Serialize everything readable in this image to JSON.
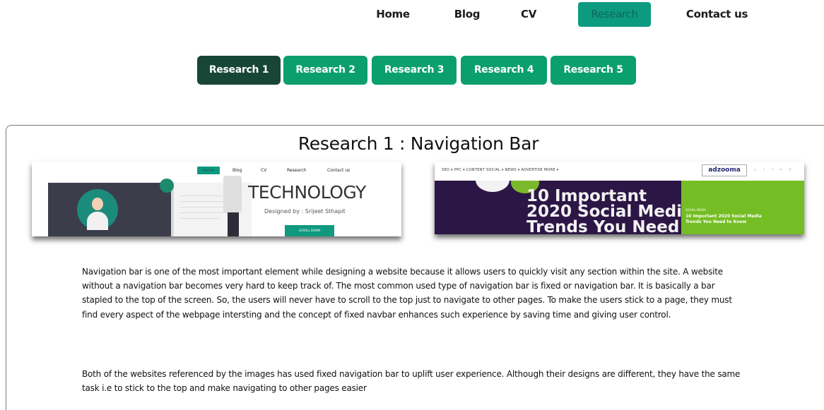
{
  "nav": {
    "items": [
      {
        "label": "Home"
      },
      {
        "label": "Blog"
      },
      {
        "label": "CV"
      },
      {
        "label": "Research",
        "active": true
      },
      {
        "label": "Contact us"
      }
    ]
  },
  "tabs": [
    {
      "label": "Research 1",
      "active": true
    },
    {
      "label": "Research 2"
    },
    {
      "label": "Research 3"
    },
    {
      "label": "Research 4"
    },
    {
      "label": "Research 5"
    }
  ],
  "panel": {
    "title": "Research 1 : Navigation Bar",
    "paragraphs": [
      "Navigation bar is one of the most important element while designing a website because it allows users to quickly visit any section within the site. A website without a navigation bar becomes very hard to keep track of. The most common used type of navigation bar is fixed or navigation bar. It is basically a bar stapled to the top of the screen. So, the users will never have to scroll to the top just to navigate to other pages. To make the users stick to a page, they must find every aspect of the webpage intersting and the concept of fixed navbar enhances such experience by saving time and giving user control.",
      "Both of the websites referenced by the images has used fixed navigation bar to uplift user experience. Although their designs are different, they have the same task i.e to stick to the top and make navigating to other pages easier"
    ]
  },
  "screenshot1": {
    "nav": [
      "Home",
      "Blog",
      "CV",
      "Research",
      "Contact us"
    ],
    "headline": "TECHNOLOGY",
    "designed_by": "Designed by : Srijeet Sthapit",
    "scroll_button": "SCROLL DOWN"
  },
  "screenshot2": {
    "menu": "SEO ▾    PPC ▾    CONTENT    SOCIAL ▾    NEWS ▾    ADVERTISE    MORE ▾",
    "logo": "adzooma",
    "social_icons": "ʌ ʏ f ▾ Q",
    "headline_line1": "10 Important",
    "headline_line2": "2020 Social Medi",
    "headline_line3": "Trends You Need",
    "side_category": "SOCIAL MEDIA",
    "side_title_line1": "10 Important 2020 Social Media",
    "side_title_line2": "Trends You Need to Know"
  },
  "colors": {
    "nav_active": "#0d9b80",
    "tab": "#0b9f6e",
    "tab_active": "#174637"
  }
}
